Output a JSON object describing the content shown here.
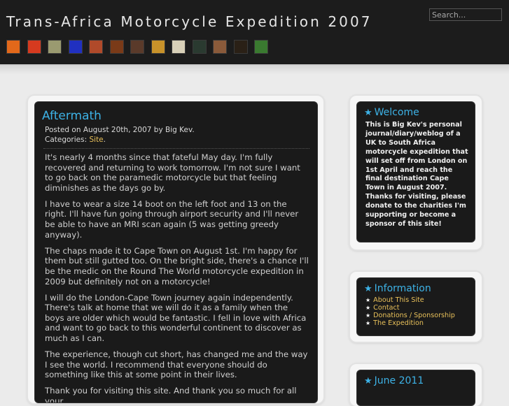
{
  "site": {
    "title": "Trans-Africa Motorcycle Expedition 2007"
  },
  "search": {
    "placeholder": "Search..."
  },
  "swatches": [
    "#e2681a",
    "#d63a1f",
    "#9a9a70",
    "#2030c0",
    "#b04a2a",
    "#7a3a18",
    "#5a3a2a",
    "#c8922a",
    "#d8d0b8",
    "#2a3a30",
    "#8a5a3a",
    "#2a2016",
    "#3a7a30"
  ],
  "post": {
    "title": "Aftermath",
    "meta_posted": "Posted on August 20th, 2007 by Big Kev.",
    "meta_categories_label": "Categories:",
    "meta_category": "Site",
    "paragraphs": [
      "It's nearly 4 months since that fateful May day. I'm fully recovered and returning to work tomorrow. I'm not sure I want to go back on the paramedic motorcycle but that feeling diminishes as the days go by.",
      "I have to wear a size 14 boot on the left foot and 13 on the right. I'll have fun going through airport security and I'll never be able to have an MRI scan again (5 was getting greedy anyway).",
      "The chaps made it to Cape Town on August 1st. I'm happy for them but still gutted too. On the bright side, there's a chance I'll be the medic on the Round The World motorcycle expedition in 2009 but definitely not on a motorcycle!",
      "I will do the London-Cape Town journey again independently. There's talk at home that we will do it as a family when the boys are older which would be fantastic. I fell in love with Africa and want to go back to this wonderful continent to discover as much as I can.",
      "The experience, though cut short, has changed me and the way I see the world. I recommend that everyone should do something like this at some point in their lives.",
      "Thank you for visiting this site. And thank you so much for all your"
    ]
  },
  "sidebar": {
    "welcome": {
      "title": "Welcome",
      "text": "This is Big Kev's personal journal/diary/weblog of a UK to South Africa motorcycle expedition that will set off from London on 1st April and reach the final destination Cape Town in August 2007. Thanks for visiting, please donate to the charities I'm supporting or become a sponsor of this site!"
    },
    "information": {
      "title": "Information",
      "items": [
        "About This Site",
        "Contact",
        "Donations / Sponsorship",
        "The Expedition"
      ]
    },
    "archive": {
      "title": "June 2011"
    }
  }
}
